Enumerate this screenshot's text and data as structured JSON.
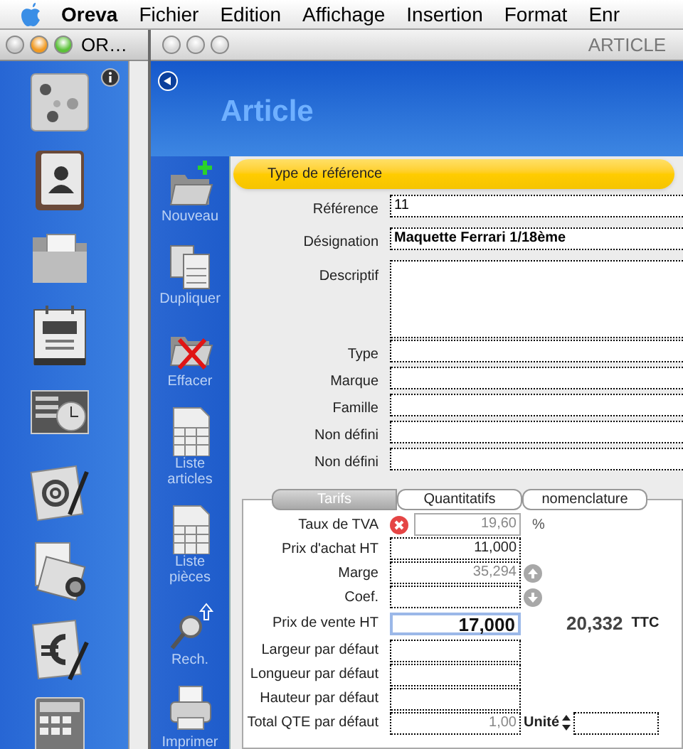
{
  "menu_bar": {
    "items": [
      {
        "label": "Oreva",
        "kind": "app"
      },
      {
        "label": "Fichier",
        "kind": "menu"
      },
      {
        "label": "Edition",
        "kind": "menu"
      },
      {
        "label": "Affichage",
        "kind": "menu"
      },
      {
        "label": "Insertion",
        "kind": "menu"
      },
      {
        "label": "Format",
        "kind": "menu"
      },
      {
        "label": "Enr",
        "kind": "menu"
      }
    ]
  },
  "palette_window": {
    "title": "OR…",
    "active": true
  },
  "main_window": {
    "title": "ARTICLE",
    "active": false,
    "header_title": "Article"
  },
  "toolbar": [
    {
      "label": "Nouveau",
      "kind": "new"
    },
    {
      "label": "Dupliquer",
      "kind": "duplicate"
    },
    {
      "label": "Effacer",
      "kind": "delete"
    },
    {
      "label": "Liste articles",
      "kind": "list"
    },
    {
      "label": "Liste pièces",
      "kind": "list"
    },
    {
      "label": "Rech.",
      "kind": "search"
    },
    {
      "label": "Imprimer",
      "kind": "print"
    }
  ],
  "form": {
    "section_title": "Type de référence",
    "fields": [
      {
        "label": "Référence",
        "value": "11",
        "kind": "text",
        "bold": false
      },
      {
        "label": "Désignation",
        "value": "Maquette Ferrari 1/18ème",
        "kind": "text",
        "bold": true
      },
      {
        "label": "Descriptif",
        "kind": "textarea"
      },
      {
        "label": "Type",
        "kind": "text"
      },
      {
        "label": "Marque",
        "kind": "text"
      },
      {
        "label": "Famille",
        "kind": "text"
      },
      {
        "label": "Non défini",
        "kind": "text"
      },
      {
        "label": "Non défini",
        "kind": "text"
      }
    ]
  },
  "tabs": [
    {
      "label": "Tarifs",
      "selected": true
    },
    {
      "label": "Quantitatifs",
      "selected": false
    },
    {
      "label": "nomenclature",
      "selected": false
    }
  ],
  "tarifs": [
    {
      "label": "Taux de TVA",
      "value": "19,60",
      "kind": "rate",
      "suffix": "%"
    },
    {
      "label": "Prix d'achat HT",
      "value": "11,000",
      "kind": "text"
    },
    {
      "label": "Marge",
      "value": "35,294",
      "kind": "margin"
    },
    {
      "label": "Coef.",
      "kind": "coef"
    },
    {
      "label": "Prix de vente HT",
      "value": "17,000",
      "kind": "price",
      "ttc_value": "20,332",
      "ttc_label": "TTC"
    },
    {
      "label": "Largeur par défaut",
      "kind": "text"
    },
    {
      "label": "Longueur par défaut",
      "kind": "text"
    },
    {
      "label": "Hauteur par défaut",
      "kind": "text"
    },
    {
      "label": "Total QTE par défaut",
      "value": "1,00",
      "kind": "computed",
      "unit_label": "Unité"
    }
  ]
}
